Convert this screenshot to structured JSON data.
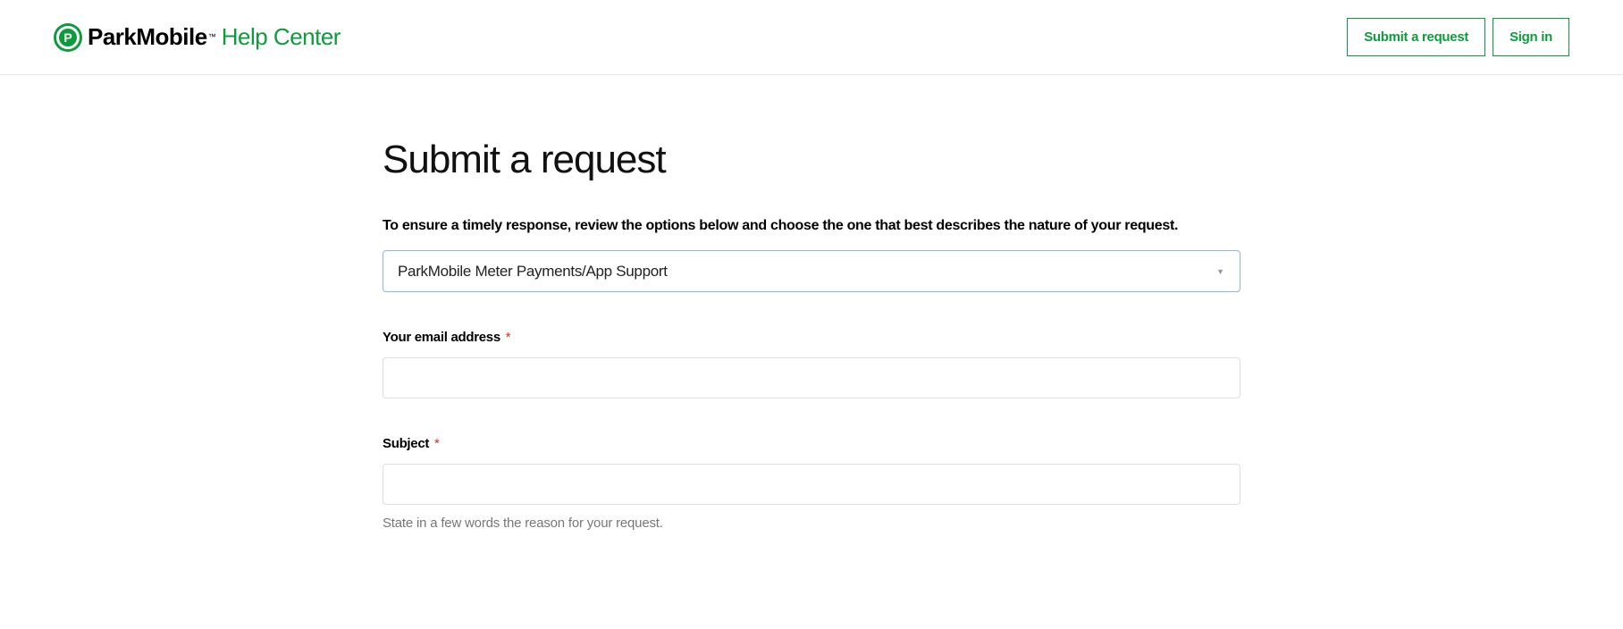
{
  "header": {
    "brand": "ParkMobile",
    "tm": "™",
    "sub": "Help Center",
    "submit_request": "Submit a request",
    "sign_in": "Sign in"
  },
  "page": {
    "title": "Submit a request",
    "instruction": "To ensure a timely response, review the options below and choose the one that best describes the nature of your request.",
    "dropdown_selected": "ParkMobile Meter Payments/App Support",
    "email_label": "Your email address",
    "email_value": "",
    "subject_label": "Subject",
    "subject_value": "",
    "subject_hint": "State in a few words the reason for your request.",
    "required_marker": "*"
  }
}
